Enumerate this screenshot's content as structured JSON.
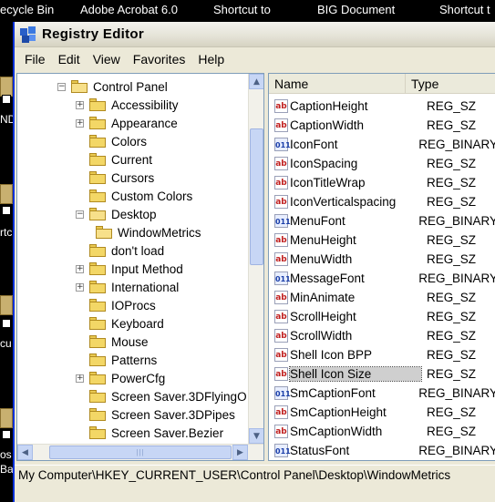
{
  "taskbar_labels": [
    "ecycle Bin",
    "Adobe Acrobat 6.0",
    "Shortcut to",
    "BIG Document",
    "Shortcut t"
  ],
  "desktop_fragments": [
    "ND",
    "rtc",
    "cu",
    "os",
    "Ba"
  ],
  "window": {
    "title": "Registry Editor"
  },
  "menu": [
    "File",
    "Edit",
    "View",
    "Favorites",
    "Help"
  ],
  "tree": {
    "items": [
      {
        "label": "Control Panel",
        "expander": "−",
        "depth": 0,
        "open": true
      },
      {
        "label": "Accessibility",
        "expander": "+",
        "depth": 1
      },
      {
        "label": "Appearance",
        "expander": "+",
        "depth": 1
      },
      {
        "label": "Colors",
        "expander": "",
        "depth": 1
      },
      {
        "label": "Current",
        "expander": "",
        "depth": 1
      },
      {
        "label": "Cursors",
        "expander": "",
        "depth": 1
      },
      {
        "label": "Custom Colors",
        "expander": "",
        "depth": 1
      },
      {
        "label": "Desktop",
        "expander": "−",
        "depth": 1,
        "open": true
      },
      {
        "label": "WindowMetrics",
        "expander": "",
        "depth": 2,
        "open": true
      },
      {
        "label": "don't load",
        "expander": "",
        "depth": 1
      },
      {
        "label": "Input Method",
        "expander": "+",
        "depth": 1
      },
      {
        "label": "International",
        "expander": "+",
        "depth": 1
      },
      {
        "label": "IOProcs",
        "expander": "",
        "depth": 1
      },
      {
        "label": "Keyboard",
        "expander": "",
        "depth": 1
      },
      {
        "label": "Mouse",
        "expander": "",
        "depth": 1
      },
      {
        "label": "Patterns",
        "expander": "",
        "depth": 1
      },
      {
        "label": "PowerCfg",
        "expander": "+",
        "depth": 1
      },
      {
        "label": "Screen Saver.3DFlyingO",
        "expander": "",
        "depth": 1
      },
      {
        "label": "Screen Saver.3DPipes",
        "expander": "",
        "depth": 1
      },
      {
        "label": "Screen Saver.Bezier",
        "expander": "",
        "depth": 1
      }
    ]
  },
  "list": {
    "columns": [
      "Name",
      "Type"
    ],
    "rows": [
      {
        "name": "CaptionHeight",
        "type": "REG_SZ",
        "icon": "ab"
      },
      {
        "name": "CaptionWidth",
        "type": "REG_SZ",
        "icon": "ab"
      },
      {
        "name": "IconFont",
        "type": "REG_BINARY",
        "icon": "011"
      },
      {
        "name": "IconSpacing",
        "type": "REG_SZ",
        "icon": "ab"
      },
      {
        "name": "IconTitleWrap",
        "type": "REG_SZ",
        "icon": "ab"
      },
      {
        "name": "IconVerticalspacing",
        "type": "REG_SZ",
        "icon": "ab"
      },
      {
        "name": "MenuFont",
        "type": "REG_BINARY",
        "icon": "011"
      },
      {
        "name": "MenuHeight",
        "type": "REG_SZ",
        "icon": "ab"
      },
      {
        "name": "MenuWidth",
        "type": "REG_SZ",
        "icon": "ab"
      },
      {
        "name": "MessageFont",
        "type": "REG_BINARY",
        "icon": "011"
      },
      {
        "name": "MinAnimate",
        "type": "REG_SZ",
        "icon": "ab"
      },
      {
        "name": "ScrollHeight",
        "type": "REG_SZ",
        "icon": "ab"
      },
      {
        "name": "ScrollWidth",
        "type": "REG_SZ",
        "icon": "ab"
      },
      {
        "name": "Shell Icon BPP",
        "type": "REG_SZ",
        "icon": "ab"
      },
      {
        "name": "Shell Icon Size",
        "type": "REG_SZ",
        "icon": "ab",
        "selected": true
      },
      {
        "name": "SmCaptionFont",
        "type": "REG_BINARY",
        "icon": "011"
      },
      {
        "name": "SmCaptionHeight",
        "type": "REG_SZ",
        "icon": "ab"
      },
      {
        "name": "SmCaptionWidth",
        "type": "REG_SZ",
        "icon": "ab"
      },
      {
        "name": "StatusFont",
        "type": "REG_BINARY",
        "icon": "011"
      }
    ]
  },
  "statusbar": {
    "path": "My Computer\\HKEY_CURRENT_USER\\Control Panel\\Desktop\\WindowMetrics"
  },
  "scrollbar": {
    "up": "▲",
    "down": "▼",
    "left": "◀",
    "right": "▶",
    "grip": "|||"
  },
  "colors": {
    "titlebar_border": "#0831d9",
    "scroll_thumb": "#c7d6f5",
    "folder": "#f3d766"
  }
}
